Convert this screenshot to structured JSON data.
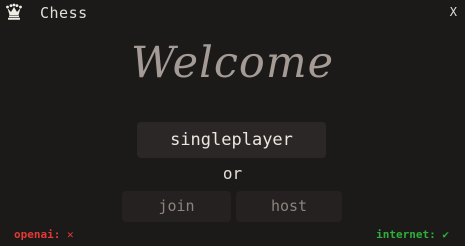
{
  "window": {
    "title": "Chess",
    "close_label": "X",
    "icon": "chess-queen-icon"
  },
  "main": {
    "heading": "Welcome",
    "singleplayer_label": "singleplayer",
    "or_label": "or",
    "join_label": "join",
    "host_label": "host"
  },
  "status": {
    "openai_label": "openai:",
    "openai_value": "✕",
    "internet_label": "internet:",
    "internet_value": "✔"
  },
  "colors": {
    "background": "#1c1a19",
    "error": "#e23a36",
    "success": "#2fae3a",
    "heading": "#a59b96"
  }
}
